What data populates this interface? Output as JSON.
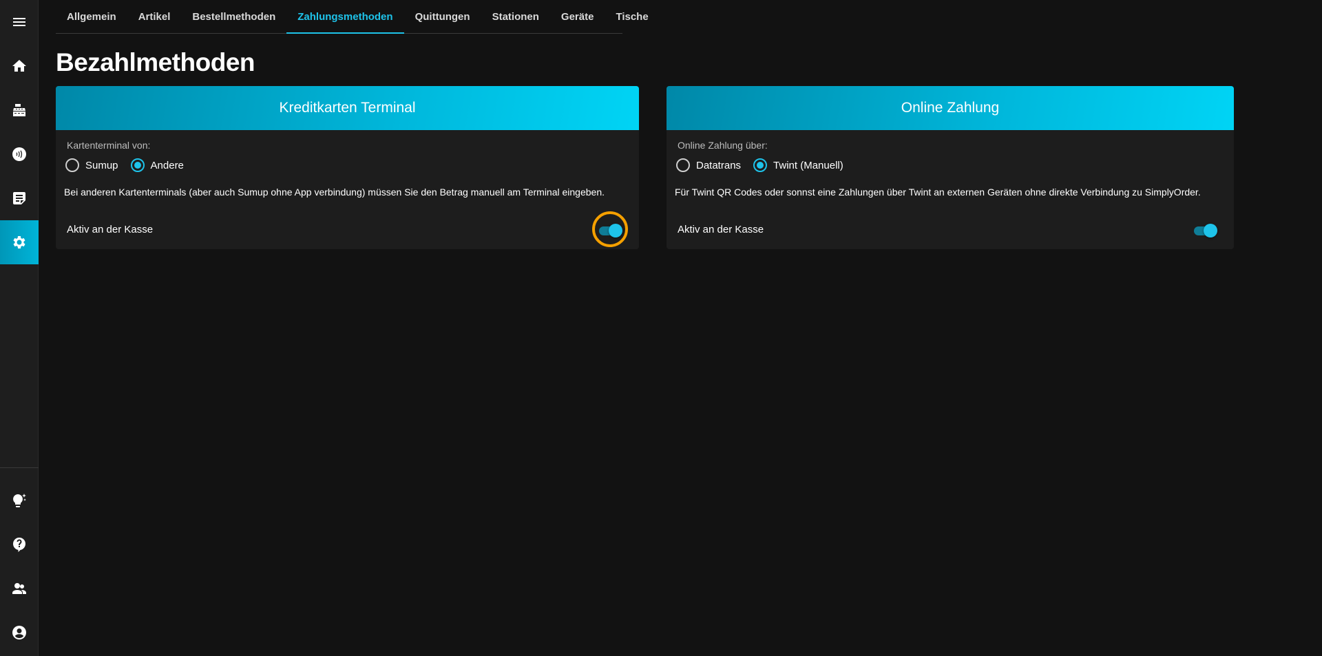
{
  "sidebar": {
    "items": [
      {
        "name": "menu-icon",
        "active": false
      },
      {
        "name": "home-icon",
        "active": false
      },
      {
        "name": "cash-register-icon",
        "active": false
      },
      {
        "name": "contactless-payment-icon",
        "active": false
      },
      {
        "name": "order-list-icon",
        "active": false
      },
      {
        "name": "settings-gear-icon",
        "active": true
      }
    ],
    "bottom_items": [
      {
        "name": "lightbulb-sparkle-icon"
      },
      {
        "name": "help-icon"
      },
      {
        "name": "team-icon"
      },
      {
        "name": "account-icon"
      }
    ]
  },
  "tabs": [
    {
      "label": "Allgemein",
      "active": false
    },
    {
      "label": "Artikel",
      "active": false
    },
    {
      "label": "Bestellmethoden",
      "active": false
    },
    {
      "label": "Zahlungsmethoden",
      "active": true
    },
    {
      "label": "Quittungen",
      "active": false
    },
    {
      "label": "Stationen",
      "active": false
    },
    {
      "label": "Geräte",
      "active": false
    },
    {
      "label": "Tische",
      "active": false
    }
  ],
  "page_title": "Bezahlmethoden",
  "cards": {
    "terminal": {
      "title": "Kreditkarten Terminal",
      "group_label": "Kartenterminal von:",
      "options": [
        {
          "label": "Sumup",
          "checked": false
        },
        {
          "label": "Andere",
          "checked": true
        }
      ],
      "description": "Bei anderen Kartenterminals (aber auch Sumup ohne App verbindung) müssen Sie den Betrag manuell am Terminal eingeben.",
      "active_label": "Aktiv an der Kasse",
      "active": true
    },
    "online": {
      "title": "Online Zahlung",
      "group_label": "Online Zahlung über:",
      "options": [
        {
          "label": "Datatrans",
          "checked": false
        },
        {
          "label": "Twint (Manuell)",
          "checked": true
        }
      ],
      "description": "Für Twint QR Codes oder sonnst eine Zahlungen über Twint an externen Geräten ohne direkte Verbindung zu SimplyOrder.",
      "active_label": "Aktiv an der Kasse",
      "active": true
    }
  },
  "colors": {
    "accent": "#1ec3ea",
    "header_gradient_start": "#0088a8",
    "header_gradient_end": "#00d4f5",
    "background": "#121212",
    "card": "#1d1d1d",
    "highlight_ring": "#f5a000"
  }
}
